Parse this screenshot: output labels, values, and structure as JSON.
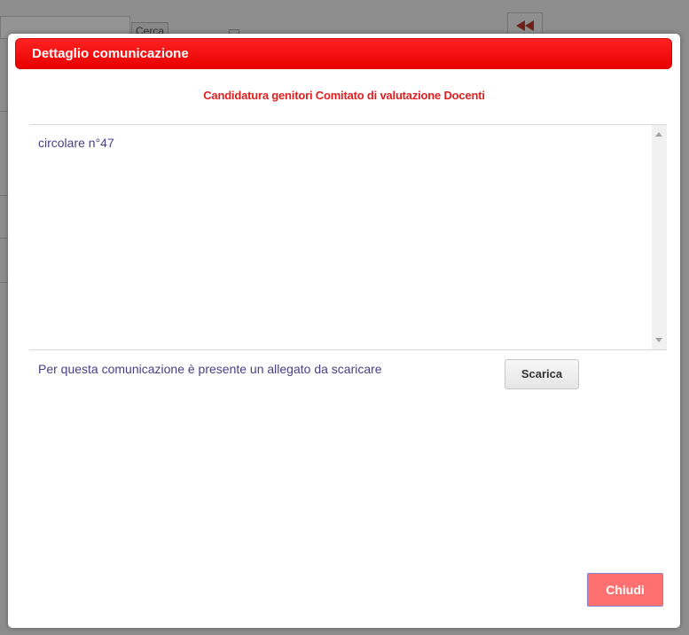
{
  "background": {
    "search_button_label": "Cerca"
  },
  "dialog": {
    "title": "Dettaglio comunicazione",
    "subject": "Candidatura genitori Comitato di valutazione Docenti",
    "body": "circolare n°47",
    "attachment_text": "Per questa comunicazione è presente un allegato da scaricare",
    "download_label": "Scarica",
    "close_label": "Chiudi"
  },
  "colors": {
    "title_bar": "#ff0000",
    "subject_text": "#e02020",
    "body_text": "#4a3d85",
    "close_button": "#ff7070"
  }
}
